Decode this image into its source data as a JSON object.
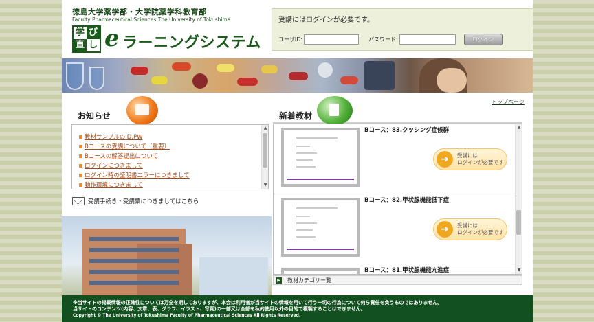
{
  "header": {
    "university_jp": "徳島大学薬学部・大学院薬学科教育部",
    "university_en": "Faculty Pharmaceutical Sciences The University of Tokushima",
    "logo_chars": [
      "学",
      "び",
      "直",
      "し"
    ],
    "e_mark": "e",
    "site_title": "ラーニングシステム"
  },
  "login": {
    "message": "受講にはログインが必要です。",
    "userid_label": "ユーザID:",
    "password_label": "パスワード:",
    "button_label": "ログイン"
  },
  "nav": {
    "top_page": "トップページ"
  },
  "news": {
    "title": "お知らせ",
    "items": [
      "教材サンプルのID,PW",
      "Bコースの受講について（重要）",
      "Bコースの解答提出について",
      "ログインにつきまして",
      "ログイン時の証明書エラーにつきまして",
      "動作環境につきまして"
    ]
  },
  "application_link": "受講手続き・受講票につきましてはこちら",
  "new_materials": {
    "title": "新着教材",
    "items": [
      {
        "title": "Bコース：83.クッシング症候群",
        "login_line1": "受講には",
        "login_line2": "ログインが必要です"
      },
      {
        "title": "Bコース：82.甲状腺機能低下症",
        "login_line1": "受講には",
        "login_line2": "ログインが必要です"
      },
      {
        "title": "Bコース：81.甲状腺機能亢進症"
      }
    ]
  },
  "category_link": "教材カテゴリー覧",
  "footer": {
    "line1": "※当サイトの掲載情報の正確性については万全を期しておりますが、本会は利用者が当サイトの情報を用いて行う一切の行為について何ら責任を負うものではありません。",
    "line2": "当サイトのコンテンツ(内容、文章、表、グラフ、イラスト、写真)の一部又は全部を私的使用以外の目的で複製することはできません。",
    "copyright": "Copyright © The University of Tokushima Faculty of Pharmaceutical Sciences All Rights Reserved."
  },
  "colors": {
    "brand_green": "#1a5a1a",
    "footer_green": "#12501f",
    "news_link": "#a34a1a",
    "accent_orange": "#f07b1c"
  },
  "icons": {
    "news_bubble": "speaker-icon",
    "new_bubble": "document-icon",
    "mail": "envelope-icon",
    "login_arrow": "arrow-right-icon"
  }
}
